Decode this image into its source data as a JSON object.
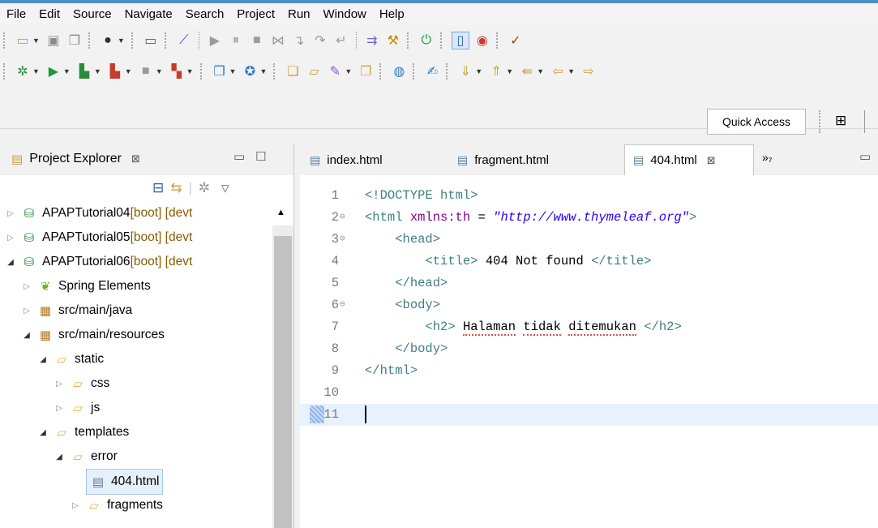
{
  "menu": [
    "File",
    "Edit",
    "Source",
    "Navigate",
    "Search",
    "Project",
    "Run",
    "Window",
    "Help"
  ],
  "quick_access": "Quick Access",
  "project_explorer": {
    "title": "Project Explorer",
    "close_symbol": "⊠",
    "items": [
      {
        "label": "APAPTutorial04",
        "deco": " [boot] [devt"
      },
      {
        "label": "APAPTutorial05",
        "deco": " [boot] [devt"
      },
      {
        "label": "APAPTutorial06",
        "deco": " [boot] [devt"
      },
      {
        "label": "Spring Elements",
        "deco": ""
      },
      {
        "label": "src/main/java",
        "deco": ""
      },
      {
        "label": "src/main/resources",
        "deco": ""
      },
      {
        "label": "static",
        "deco": ""
      },
      {
        "label": "css",
        "deco": ""
      },
      {
        "label": "js",
        "deco": ""
      },
      {
        "label": "templates",
        "deco": ""
      },
      {
        "label": "error",
        "deco": ""
      },
      {
        "label": "404.html",
        "deco": ""
      },
      {
        "label": "fragments",
        "deco": ""
      }
    ]
  },
  "editor": {
    "tabs": [
      {
        "label": "index.html"
      },
      {
        "label": "fragment.html"
      },
      {
        "label": "404.html",
        "close": "⊠"
      }
    ],
    "overflow": "»₇",
    "lines": [
      {
        "n": "1",
        "parts": [
          [
            "tag",
            "<!DOCTYPE html>"
          ]
        ]
      },
      {
        "n": "2",
        "parts": [
          [
            "tag",
            "<html "
          ],
          [
            "attr",
            "xmlns:th"
          ],
          [
            "plain",
            " = "
          ],
          [
            "str",
            "\"http://www.thymeleaf.org\""
          ],
          [
            "tag",
            ">"
          ]
        ]
      },
      {
        "n": "3",
        "parts": [
          [
            "plain",
            "    "
          ],
          [
            "tag",
            "<head>"
          ]
        ]
      },
      {
        "n": "4",
        "parts": [
          [
            "plain",
            "        "
          ],
          [
            "tag",
            "<title>"
          ],
          [
            "plain",
            " 404 Not found "
          ],
          [
            "tag",
            "</title>"
          ]
        ]
      },
      {
        "n": "5",
        "parts": [
          [
            "plain",
            "    "
          ],
          [
            "tag",
            "</head>"
          ]
        ]
      },
      {
        "n": "6",
        "parts": [
          [
            "plain",
            "    "
          ],
          [
            "tag",
            "<body>"
          ]
        ]
      },
      {
        "n": "7",
        "parts": [
          [
            "plain",
            "        "
          ],
          [
            "tag",
            "<h2>"
          ],
          [
            "plain",
            " "
          ],
          [
            "spell",
            "Halaman"
          ],
          [
            "plain",
            " "
          ],
          [
            "spell",
            "tidak"
          ],
          [
            "plain",
            " "
          ],
          [
            "spell",
            "ditemukan"
          ],
          [
            "plain",
            " "
          ],
          [
            "tag",
            "</h2>"
          ]
        ]
      },
      {
        "n": "8",
        "parts": [
          [
            "plain",
            "    "
          ],
          [
            "tag",
            "</body>"
          ]
        ]
      },
      {
        "n": "9",
        "parts": [
          [
            "tag",
            "</html>"
          ]
        ]
      },
      {
        "n": "10",
        "parts": []
      },
      {
        "n": "11",
        "parts": []
      }
    ]
  },
  "colors": {
    "tag": "#3f7f7f",
    "attr": "#7f007f",
    "string": "#2a00ff",
    "current_line": "#e8f2fe"
  }
}
